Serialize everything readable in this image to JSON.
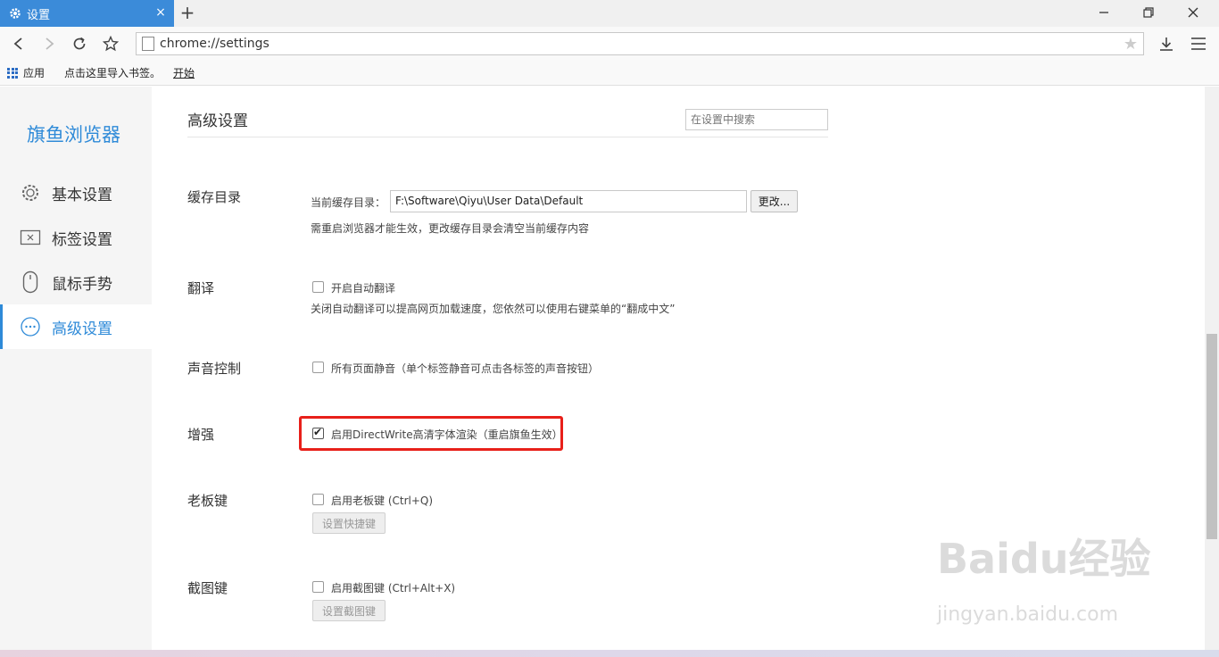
{
  "tab": {
    "title": "设置",
    "close": "×",
    "new_tab": "+"
  },
  "toolbar": {
    "url": "chrome://settings"
  },
  "bookmarks": {
    "apps": "应用",
    "import": "点击这里导入书签。",
    "start": "开始"
  },
  "sidebar": {
    "brand": "旗鱼浏览器",
    "items": [
      {
        "label": "基本设置",
        "icon": "gear-icon"
      },
      {
        "label": "标签设置",
        "icon": "tab-icon"
      },
      {
        "label": "鼠标手势",
        "icon": "mouse-icon"
      },
      {
        "label": "高级设置",
        "icon": "more-icon",
        "active": true
      }
    ]
  },
  "main": {
    "title": "高级设置",
    "search_placeholder": "在设置中搜索",
    "cache": {
      "label": "缓存目录",
      "current_label": "当前缓存目录：",
      "path": "F:\\Software\\Qiyu\\User Data\\Default",
      "change_button": "更改...",
      "note": "需重启浏览器才能生效，更改缓存目录会清空当前缓存内容"
    },
    "translate": {
      "label": "翻译",
      "checkbox": "开启自动翻译",
      "checked": false,
      "note": "关闭自动翻译可以提高网页加载速度，您依然可以使用右键菜单的“翻成中文”"
    },
    "sound": {
      "label": "声音控制",
      "checkbox": "所有页面静音（单个标签静音可点击各标签的声音按钮）",
      "checked": false
    },
    "enhance": {
      "label": "增强",
      "checkbox": "启用DirectWrite高清字体渲染（重启旗鱼生效）",
      "checked": true
    },
    "boss_key": {
      "label": "老板键",
      "checkbox": "启用老板键 (Ctrl+Q)",
      "checked": false,
      "button": "设置快捷键"
    },
    "screenshot": {
      "label": "截图键",
      "checkbox": "启用截图键 (Ctrl+Alt+X)",
      "checked": false,
      "button": "设置截图键"
    }
  },
  "watermark": {
    "line1": "Baidu经验",
    "line2": "jingyan.baidu.com"
  },
  "colors": {
    "accent": "#2e8ad8",
    "tab": "#3b8bd9",
    "highlight": "#e8201a"
  }
}
